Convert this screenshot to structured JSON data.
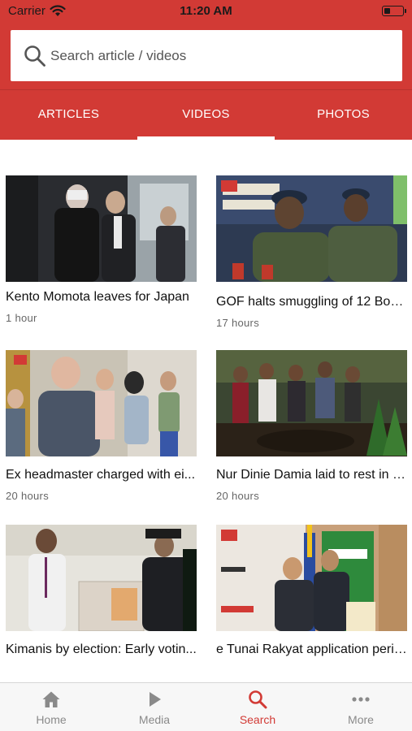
{
  "status_bar": {
    "carrier": "Carrier",
    "time": "11:20 AM"
  },
  "search": {
    "placeholder": "Search article / videos",
    "value": ""
  },
  "tabs": [
    {
      "label": "ARTICLES",
      "selected": false
    },
    {
      "label": "VIDEOS",
      "selected": true
    },
    {
      "label": "PHOTOS",
      "selected": false
    }
  ],
  "videos": [
    {
      "title": "Kento Momota leaves for Japan",
      "time": "1 hour",
      "thumbnail": "momota-airport-photo"
    },
    {
      "title": "GOF halts smuggling of 12 Boe...",
      "time": "17 hours",
      "thumbnail": "gof-officers-press-photo"
    },
    {
      "title": "Ex headmaster charged with ei...",
      "time": "20 hours",
      "thumbnail": "headmaster-court-photo"
    },
    {
      "title": "Nur Dinie Damia laid to rest in P...",
      "time": "20 hours",
      "thumbnail": "burial-crowd-photo"
    },
    {
      "title": "Kimanis by election: Early votin...",
      "time": "",
      "thumbnail": "early-voting-ballot-photo"
    },
    {
      "title": "e Tunai Rakyat application perio...",
      "time": "",
      "thumbnail": "e-tunai-press-conference-photo"
    }
  ],
  "bottom_nav": [
    {
      "label": "Home",
      "icon": "home-icon",
      "active": false
    },
    {
      "label": "Media",
      "icon": "play-icon",
      "active": false
    },
    {
      "label": "Search",
      "icon": "search-icon",
      "active": true
    },
    {
      "label": "More",
      "icon": "more-dots-icon",
      "active": false
    }
  ],
  "colors": {
    "brand_red": "#d23a35",
    "tab_text": "#ffffff",
    "inactive_nav": "#8a8a8a",
    "active_nav": "#d23a35"
  }
}
